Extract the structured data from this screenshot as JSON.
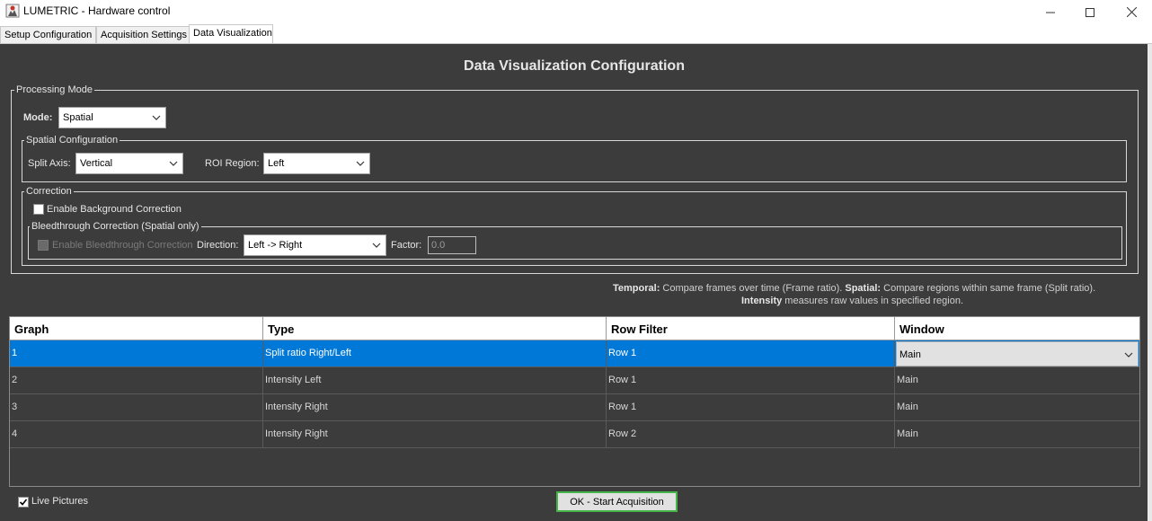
{
  "window": {
    "title": "LUMETRIC - Hardware control",
    "icons": [
      "app-icon",
      "minimize-icon",
      "maximize-icon",
      "close-icon"
    ]
  },
  "tabs": [
    {
      "label": "Setup Configuration",
      "active": false
    },
    {
      "label": "Acquisition Settings",
      "active": false
    },
    {
      "label": "Data Visualization",
      "active": true
    }
  ],
  "heading": "Data Visualization Configuration",
  "processing": {
    "group_title": "Processing Mode",
    "mode_label": "Mode:",
    "mode_value": "Spatial",
    "spatial": {
      "group_title": "Spatial Configuration",
      "split_axis_label": "Split Axis:",
      "split_axis_value": "Vertical",
      "roi_label": "ROI Region:",
      "roi_value": "Left"
    },
    "correction": {
      "group_title": "Correction",
      "background_label": "Enable Background Correction",
      "background_checked": false,
      "bleed": {
        "group_title": "Bleedthrough Correction (Spatial only)",
        "enable_label": "Enable Bleedthrough Correction",
        "enable_checked": false,
        "direction_label": "Direction:",
        "direction_value": "Left -> Right",
        "factor_label": "Factor:",
        "factor_value": "0.0"
      }
    }
  },
  "help": {
    "temporal_term": "Temporal:",
    "temporal_text": " Compare frames over time (Frame ratio). ",
    "spatial_term": "Spatial:",
    "spatial_text": " Compare regions within same frame (Split ratio).",
    "intensity_term": "Intensity",
    "intensity_text": " measures raw values in specified region."
  },
  "table": {
    "columns": [
      "Graph",
      "Type",
      "Row Filter",
      "Window"
    ],
    "rows": [
      {
        "graph": "1",
        "type": "Split ratio Right/Left",
        "row_filter": "Row 1",
        "window": "Main",
        "selected": true
      },
      {
        "graph": "2",
        "type": "Intensity Left",
        "row_filter": "Row 1",
        "window": "Main",
        "selected": false
      },
      {
        "graph": "3",
        "type": "Intensity Right",
        "row_filter": "Row 1",
        "window": "Main",
        "selected": false
      },
      {
        "graph": "4",
        "type": "Intensity Right",
        "row_filter": "Row 2",
        "window": "Main",
        "selected": false
      }
    ]
  },
  "footer": {
    "live_pictures_label": "Live Pictures",
    "live_pictures_checked": true,
    "ok_label": "OK - Start Acquisition"
  },
  "colors": {
    "panel_background": "#3c3c3c",
    "selection": "#0078d7",
    "ok_border": "#45b548"
  }
}
